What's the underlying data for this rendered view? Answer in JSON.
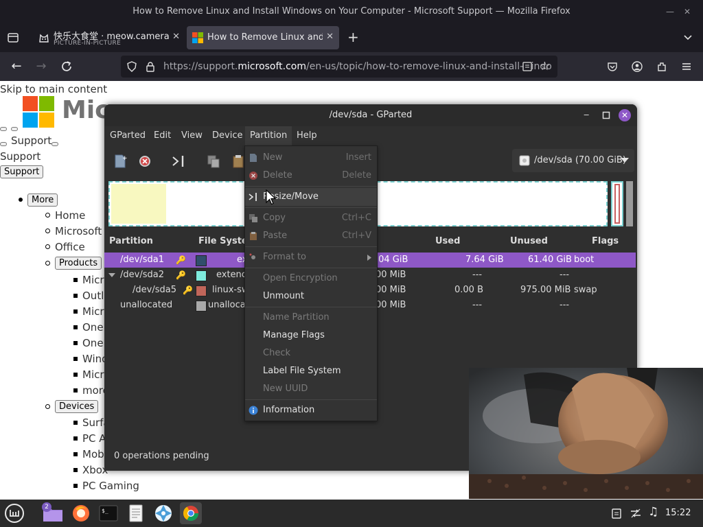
{
  "browser": {
    "window_title": "How to Remove Linux and Install Windows on Your Computer - Microsoft Support — Mozilla Firefox",
    "tabs": [
      {
        "title": "快乐大食堂 · meow.camera",
        "subtitle": "PICTURE-IN-PICTURE"
      },
      {
        "title": "How to Remove Linux and I"
      }
    ],
    "url_prefix": "https://support.",
    "url_host": "microsoft.com",
    "url_path": "/en-us/topic/how-to-remove-linux-and-install-windo"
  },
  "page": {
    "skip_link": "Skip to main content",
    "logo_text": "Mic",
    "support_link": "Support",
    "support_heading": "Support",
    "support_button": "Support",
    "more_button": "More",
    "nav_items": [
      "Home",
      "Microsoft 3",
      "Office"
    ],
    "products_button": "Products",
    "product_items": [
      "Micr",
      "Outl",
      "Micr",
      "OneI",
      "OneI",
      "Wind",
      "Micr",
      "more"
    ],
    "devices_button": "Devices",
    "device_items": [
      "Surfa",
      "PC A",
      "Mob",
      "Xbox",
      "PC Gaming"
    ]
  },
  "gparted": {
    "title": "/dev/sda - GParted",
    "menus": [
      "GParted",
      "Edit",
      "View",
      "Device",
      "Partition",
      "Help"
    ],
    "device_selector": "/dev/sda (70.00 GiB)",
    "columns": [
      "Partition",
      "File System",
      "Used",
      "Unused",
      "Flags"
    ],
    "rows": [
      {
        "partition": "/dev/sda1",
        "fs": "ex",
        "size": ".04 GiB",
        "used": "7.64 GiB",
        "unused": "61.40 GiB",
        "flags": "boot",
        "color": "#314e6c"
      },
      {
        "partition": "/dev/sda2",
        "fs": "extenc",
        "size": "00 MiB",
        "used": "---",
        "unused": "---",
        "flags": "",
        "color": "#7eebdd"
      },
      {
        "partition": "/dev/sda5",
        "fs": "linux-sw",
        "size": "00 MiB",
        "used": "0.00 B",
        "unused": "975.00 MiB",
        "flags": "swap",
        "color": "#c1665a"
      },
      {
        "partition": "unallocated",
        "fs": "unalloca",
        "size": "00 MiB",
        "used": "---",
        "unused": "---",
        "flags": "",
        "color": "#a9a9a9"
      }
    ],
    "status": "0 operations pending"
  },
  "partition_menu": {
    "items": [
      {
        "label": "New",
        "accel": "Insert",
        "enabled": false
      },
      {
        "label": "Delete",
        "accel": "Delete",
        "enabled": false
      },
      {
        "label": "Resize/Move",
        "accel": "",
        "enabled": true
      },
      {
        "label": "Copy",
        "accel": "Ctrl+C",
        "enabled": false
      },
      {
        "label": "Paste",
        "accel": "Ctrl+V",
        "enabled": false
      },
      {
        "label": "Format to",
        "accel": "",
        "enabled": false
      },
      {
        "label": "Open Encryption",
        "accel": "",
        "enabled": false
      },
      {
        "label": "Unmount",
        "accel": "",
        "enabled": true
      },
      {
        "label": "Name Partition",
        "accel": "",
        "enabled": false
      },
      {
        "label": "Manage Flags",
        "accel": "",
        "enabled": true
      },
      {
        "label": "Check",
        "accel": "",
        "enabled": false
      },
      {
        "label": "Label File System",
        "accel": "",
        "enabled": true
      },
      {
        "label": "New UUID",
        "accel": "",
        "enabled": false
      },
      {
        "label": "Information",
        "accel": "",
        "enabled": true
      }
    ]
  },
  "taskbar": {
    "folder_badge": "2",
    "clock": "15:22"
  },
  "colors": {
    "accent": "#8e58c7",
    "firefox_dark": "#1c1b22"
  }
}
